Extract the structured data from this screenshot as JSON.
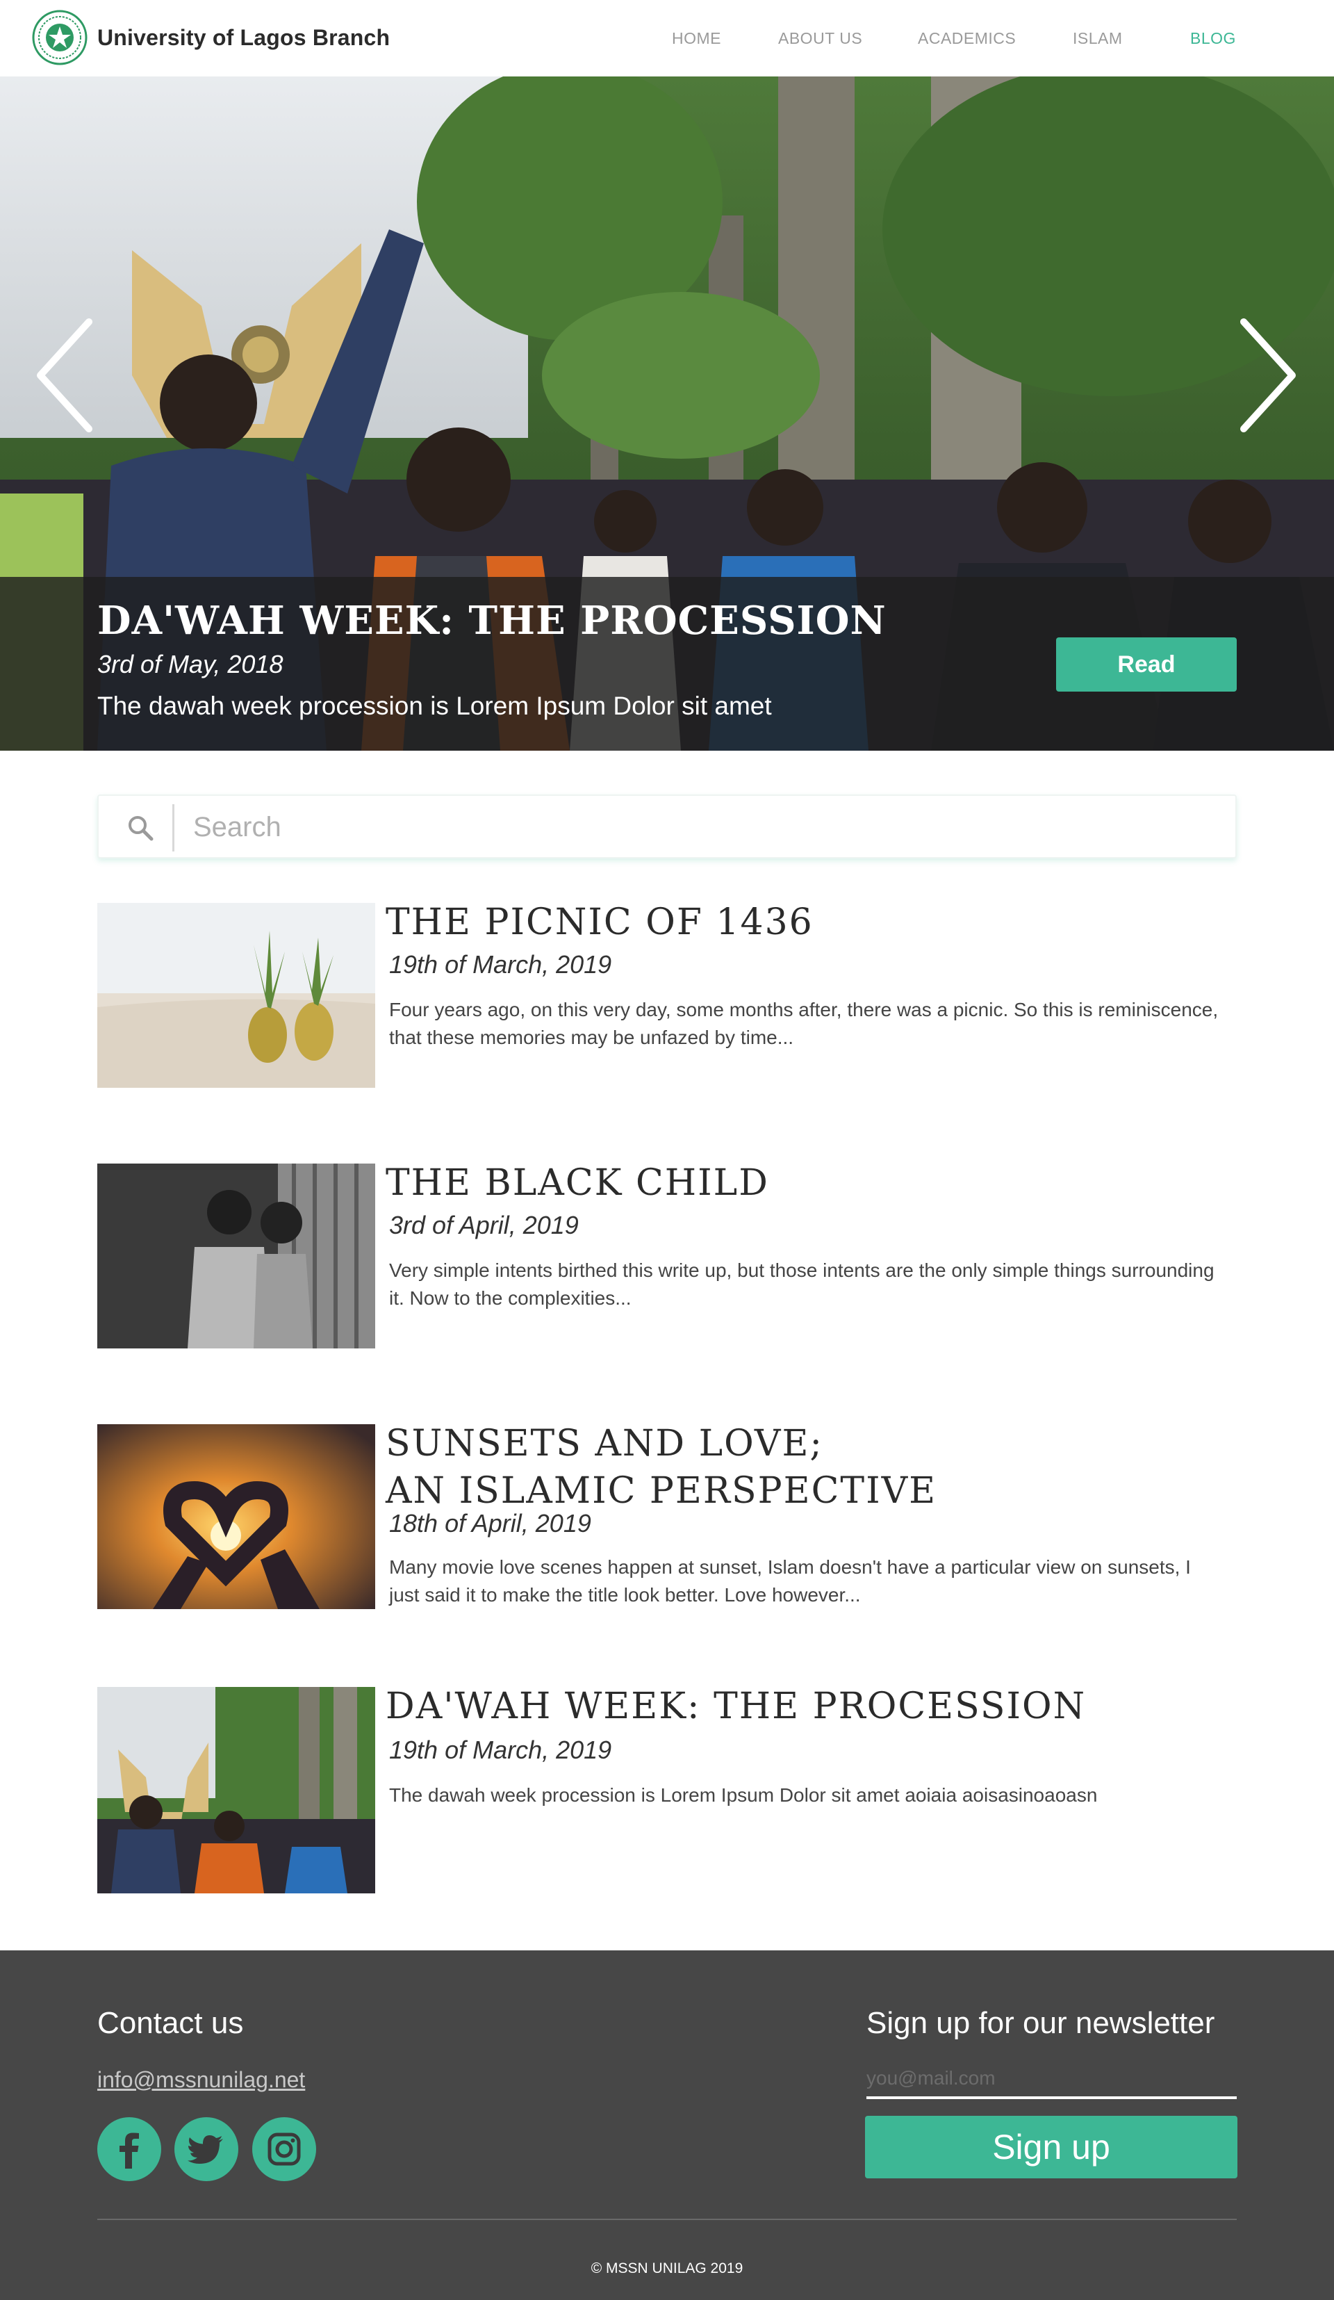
{
  "header": {
    "site_title": "University of Lagos Branch",
    "logo_icon": "mssn-crest-logo",
    "nav": [
      {
        "label": "HOME",
        "active": false
      },
      {
        "label": "ABOUT US",
        "active": false
      },
      {
        "label": "ACADEMICS",
        "active": false
      },
      {
        "label": "ISLAM",
        "active": false
      },
      {
        "label": "BLOG",
        "active": true
      }
    ]
  },
  "hero": {
    "title": "DA'WAH WEEK: THE PROCESSION",
    "date": "3rd of May, 2018",
    "summary": "The dawah week procession is Lorem Ipsum Dolor sit amet",
    "read_label": "Read",
    "prev_icon": "chevron-left-icon",
    "next_icon": "chevron-right-icon"
  },
  "search": {
    "placeholder": "Search",
    "value": "",
    "icon": "search-icon"
  },
  "posts": [
    {
      "title": "THE PICNIC OF 1436",
      "date": "19th of March, 2019",
      "excerpt": "Four years ago, on this very day, some months after, there was a picnic. So this is reminiscence, that these memories may be unfazed by time...",
      "image": "pineapples-on-beach"
    },
    {
      "title": "THE BLACK CHILD",
      "date": "3rd of April, 2019",
      "excerpt": "Very simple intents birthed this write up, but those intents are the only simple things surrounding it. Now to the complexities...",
      "image": "two-children-black-and-white"
    },
    {
      "title_line1": "SUNSETS AND LOVE;",
      "title_line2": "AN ISLAMIC PERSPECTIVE",
      "date": "18th of April, 2019",
      "excerpt": "Many movie love scenes happen at sunset, Islam doesn't have a particular view on sunsets, I just said it to make the title look better. Love however...",
      "image": "heart-hands-sunset"
    },
    {
      "title": "DA'WAH WEEK: THE PROCESSION",
      "date": "19th of March, 2019",
      "excerpt": "The dawah week procession is Lorem Ipsum Dolor sit amet aoiaia aoisasinoaoasn",
      "image": "procession-crowd"
    }
  ],
  "footer": {
    "contact_heading": "Contact us",
    "email": "info@mssnunilag.net",
    "social": [
      "facebook-icon",
      "twitter-icon",
      "instagram-icon"
    ],
    "newsletter_heading": "Sign up for our newsletter",
    "newsletter_placeholder": "you@mail.com",
    "signup_label": "Sign up",
    "copyright": "© MSSN UNILAG 2019"
  },
  "colors": {
    "accent": "#3db795",
    "footer_bg": "#474747",
    "caption_bg": "#1e1e1e",
    "nav_text": "#9a9a9a"
  }
}
